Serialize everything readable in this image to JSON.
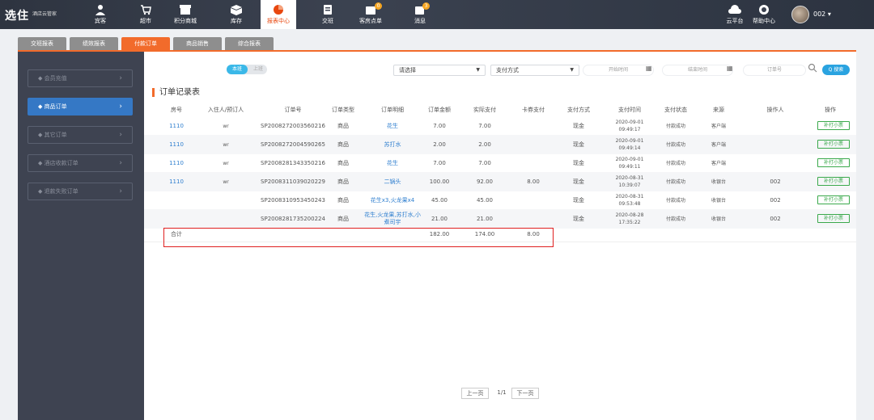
{
  "app": {
    "logo": "选住",
    "logo_sub": "酒店云管家"
  },
  "nav": [
    {
      "label": "宾客",
      "icon": "guests-icon"
    },
    {
      "label": "超市",
      "icon": "cart-icon"
    },
    {
      "label": "积分商城",
      "icon": "store-icon"
    },
    {
      "label": "库存",
      "icon": "inventory-icon"
    },
    {
      "label": "报表中心",
      "icon": "report-icon"
    },
    {
      "label": "交班",
      "icon": "shift-icon"
    },
    {
      "label": "客房点单",
      "icon": "room-order-icon",
      "badge": "0"
    },
    {
      "label": "消息",
      "icon": "message-icon",
      "badge": "3"
    }
  ],
  "right_nav": [
    {
      "label": "云平台",
      "icon": "cloud-icon"
    },
    {
      "label": "帮助中心",
      "icon": "help-icon"
    }
  ],
  "user": {
    "name": "002"
  },
  "tabs": [
    "交班报表",
    "绩效报表",
    "付款订单",
    "商品销售",
    "综合报表"
  ],
  "sidebar": [
    "会员充值",
    "商品订单",
    "其它订单",
    "酒店收款订单",
    "退款失败订单"
  ],
  "filters": {
    "toggle_on": "本班",
    "toggle_off": "上班",
    "store_select": "请选择",
    "pay_select": "支付方式",
    "start_time": "开始时间",
    "end_time": "结束时间",
    "order_no": "订单号",
    "search_btn": "Q 搜索"
  },
  "section_title": "订单记录表",
  "columns": [
    "房号",
    "入住人/预订人",
    "订单号",
    "订单类型",
    "订单明细",
    "订单金额",
    "实际支付",
    "卡券支付",
    "支付方式",
    "支付时间",
    "支付状态",
    "来源",
    "操作人",
    "操作"
  ],
  "rows": [
    {
      "room": "1110",
      "guest": "wr",
      "order": "SP2008272003560216",
      "type": "商品",
      "detail": "花生",
      "amount": "7.00",
      "paid": "7.00",
      "coupon": "",
      "method": "现金",
      "date": "2020-09-01",
      "time": "09:49:17",
      "status": "付款成功",
      "source": "客户端",
      "operator": "",
      "action": "补打小票"
    },
    {
      "room": "1110",
      "guest": "wr",
      "order": "SP2008272004590265",
      "type": "商品",
      "detail": "苏打水",
      "amount": "2.00",
      "paid": "2.00",
      "coupon": "",
      "method": "现金",
      "date": "2020-09-01",
      "time": "09:49:14",
      "status": "付款成功",
      "source": "客户端",
      "operator": "",
      "action": "补打小票"
    },
    {
      "room": "1110",
      "guest": "wr",
      "order": "SP2008281343350216",
      "type": "商品",
      "detail": "花生",
      "amount": "7.00",
      "paid": "7.00",
      "coupon": "",
      "method": "现金",
      "date": "2020-09-01",
      "time": "09:49:11",
      "status": "付款成功",
      "source": "客户端",
      "operator": "",
      "action": "补打小票"
    },
    {
      "room": "1110",
      "guest": "wr",
      "order": "SP2008311039020229",
      "type": "商品",
      "detail": "二锅头",
      "amount": "100.00",
      "paid": "92.00",
      "coupon": "8.00",
      "method": "现金",
      "date": "2020-08-31",
      "time": "10:39:07",
      "status": "付款成功",
      "source": "收银台",
      "operator": "002",
      "action": "补打小票"
    },
    {
      "room": "",
      "guest": "",
      "order": "SP2008310953450243",
      "type": "商品",
      "detail": "花生x3,火龙果x4",
      "amount": "45.00",
      "paid": "45.00",
      "coupon": "",
      "method": "现金",
      "date": "2020-08-31",
      "time": "09:53:48",
      "status": "付款成功",
      "source": "收银台",
      "operator": "002",
      "action": "补打小票"
    },
    {
      "room": "",
      "guest": "",
      "order": "SP2008281735200224",
      "type": "商品",
      "detail": "花生,火龙果,苏打水,小煮司宇",
      "amount": "21.00",
      "paid": "21.00",
      "coupon": "",
      "method": "现金",
      "date": "2020-08-28",
      "time": "17:35:22",
      "status": "付款成功",
      "source": "收银台",
      "operator": "002",
      "action": "补打小票"
    }
  ],
  "totals": {
    "label": "合计",
    "amount": "182.00",
    "paid": "174.00",
    "coupon": "8.00"
  },
  "pager": {
    "prev": "上一页",
    "info": "1/1",
    "next": "下一页"
  },
  "colors": {
    "accent": "#f26b2b",
    "link": "#2f7fcf",
    "sidebar": "#3e4351",
    "highlight": "#e02020",
    "reprint": "#3aa94b"
  }
}
